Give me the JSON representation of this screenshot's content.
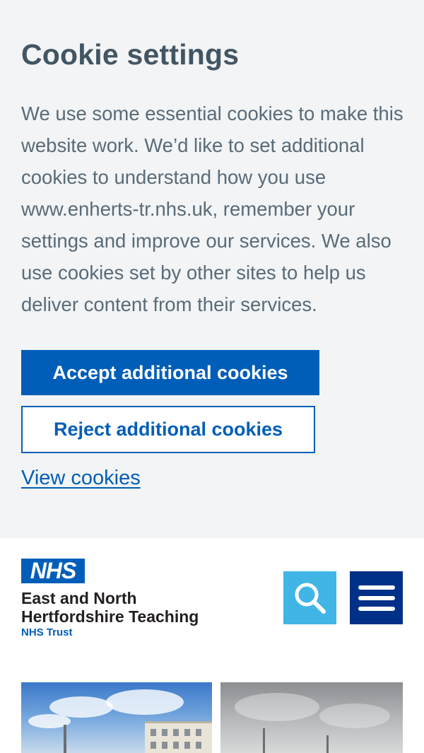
{
  "cookie_banner": {
    "title": "Cookie settings",
    "body": "We use some essential cookies to make this website work. We’d like to set additional cookies to understand how you use www.enherts-tr.nhs.uk, remember your settings and improve our services. We also use cookies set by other sites to help us deliver content from their services.",
    "accept_label": "Accept additional cookies",
    "reject_label": "Reject additional cookies",
    "view_label": "View cookies"
  },
  "header": {
    "logo_text": "NHS",
    "org_line_1": "East and North",
    "org_line_2": "Hertfordshire Teaching",
    "org_sub": "NHS Trust",
    "search_icon": "search-icon",
    "menu_icon": "hamburger-menu-icon"
  },
  "colors": {
    "nhs_blue": "#005eb8",
    "banner_bg": "#f2f4f5",
    "search_bg": "#41b6e6",
    "menu_bg": "#003087",
    "text": "#425563"
  }
}
